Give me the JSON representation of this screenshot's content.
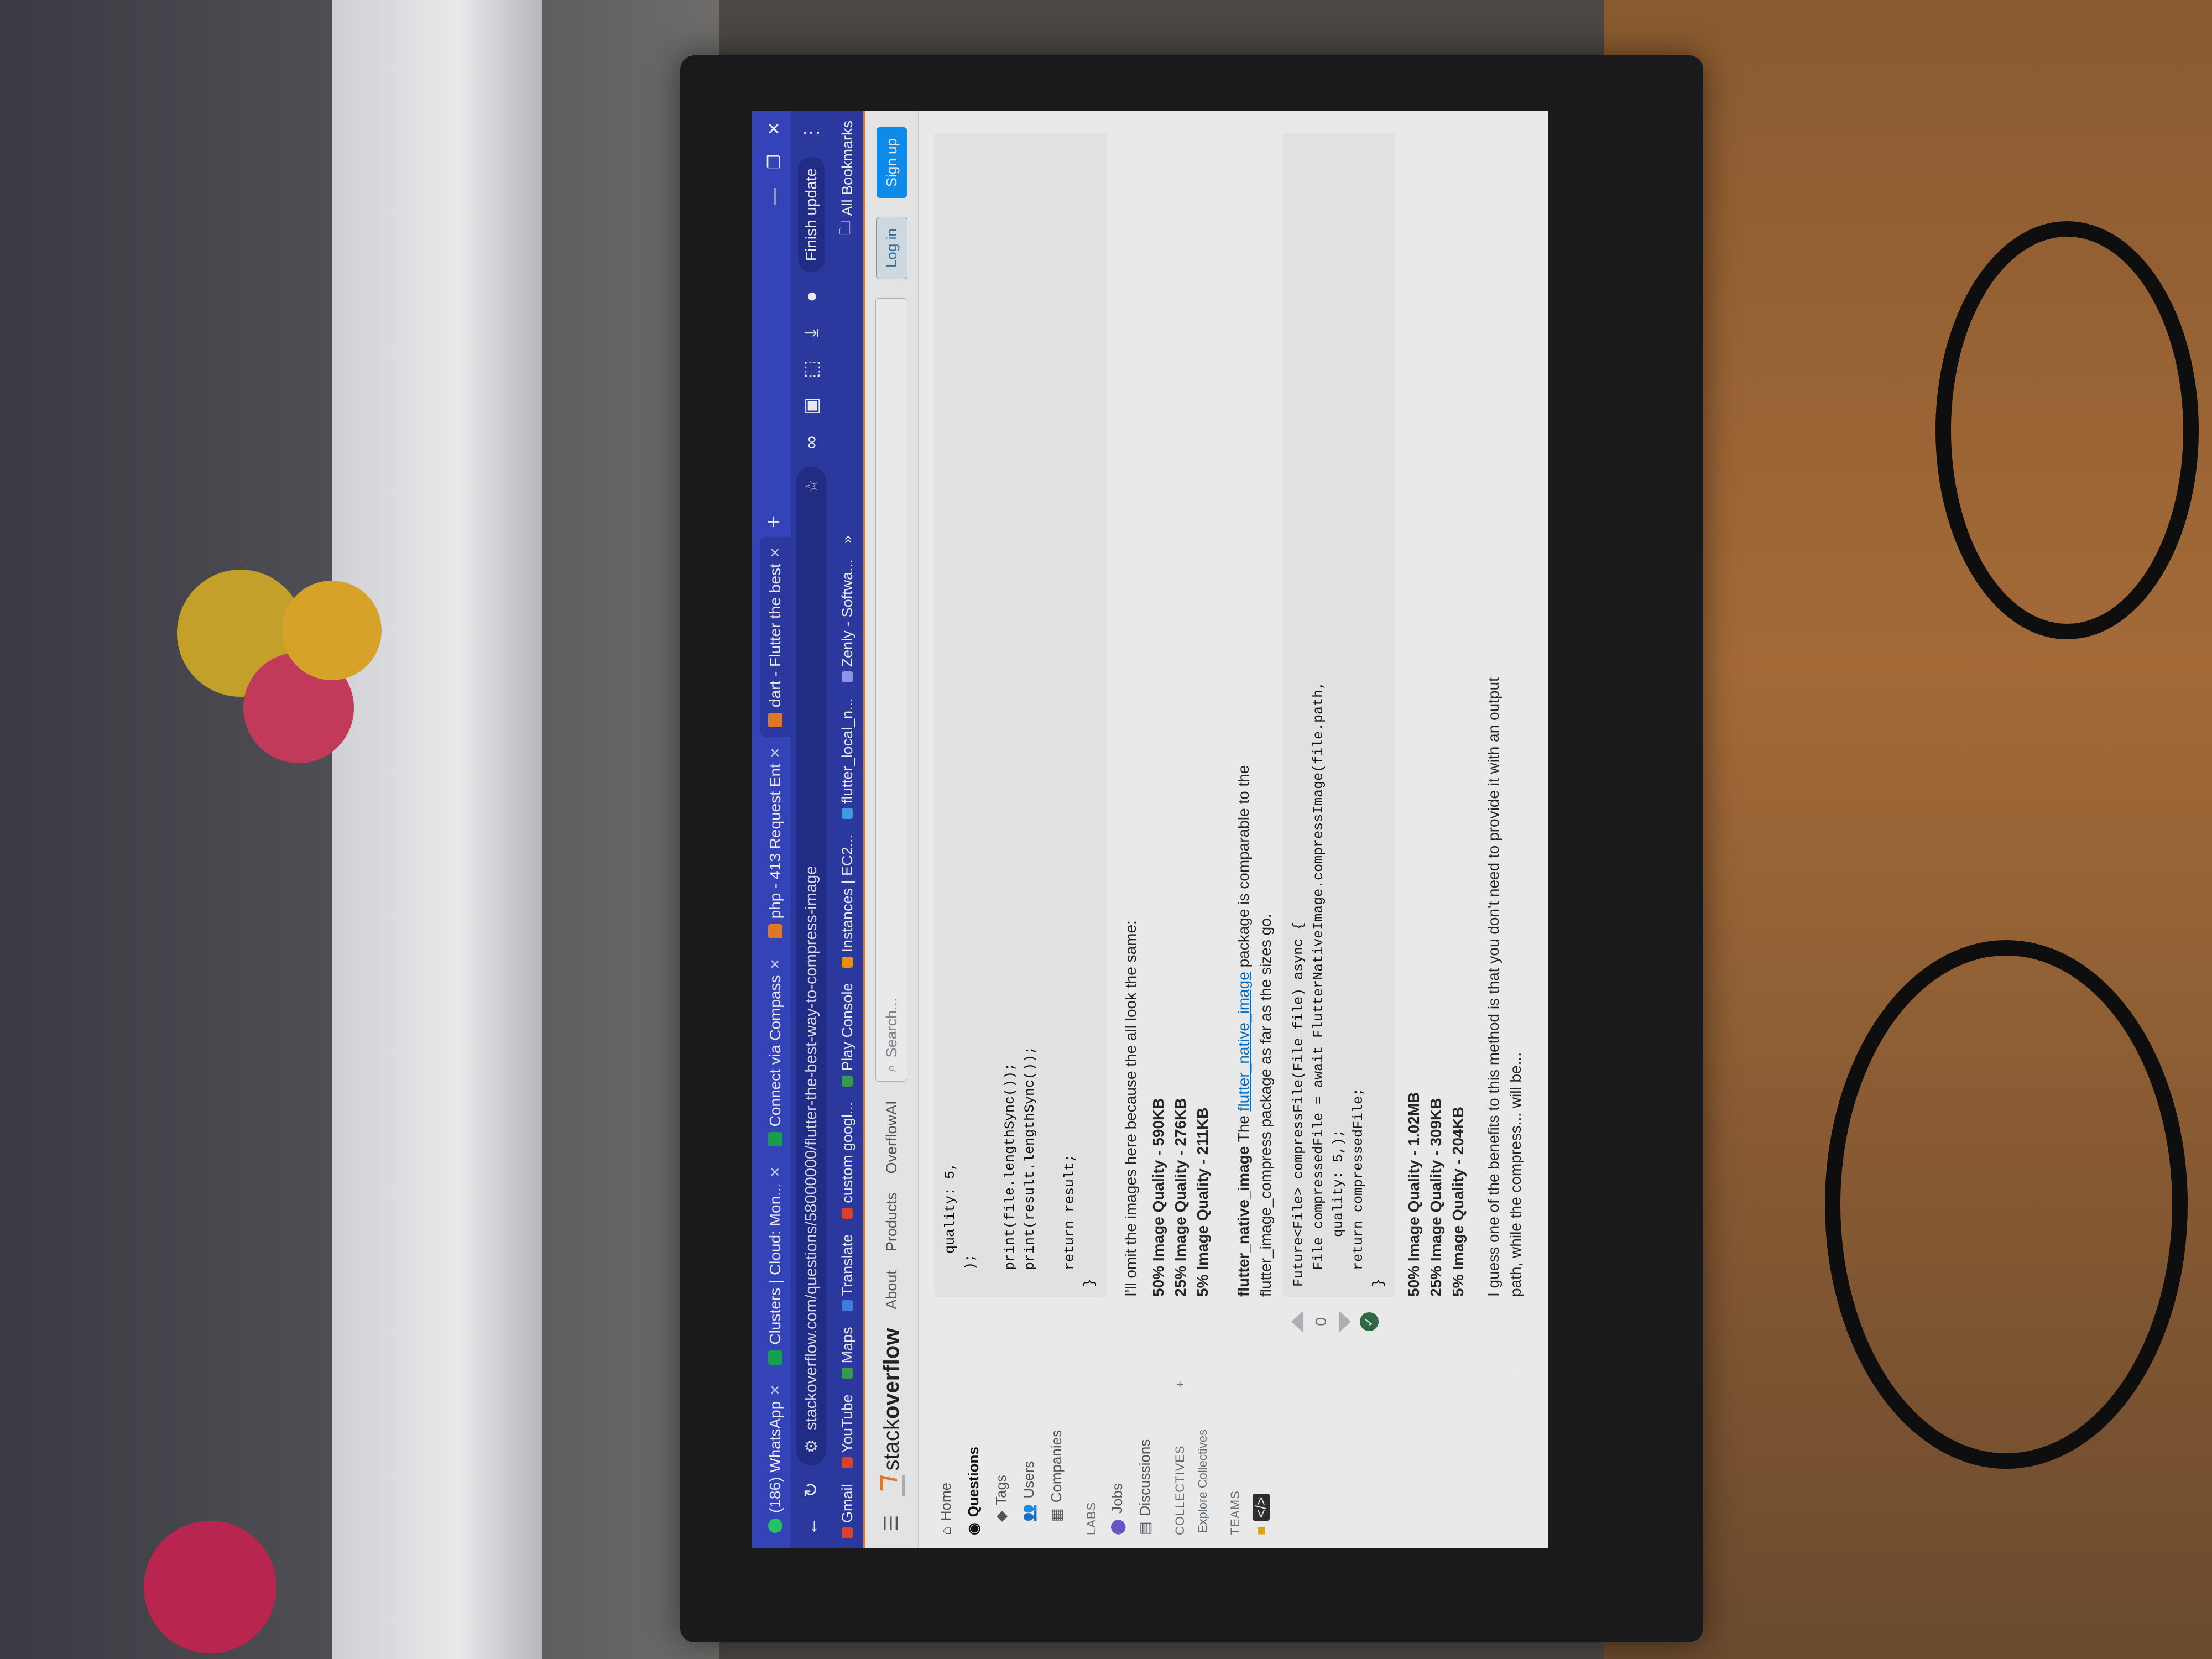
{
  "browser": {
    "tabs": [
      {
        "label": "(186) WhatsApp"
      },
      {
        "label": "Clusters | Cloud: Mon..."
      },
      {
        "label": "Connect via Compass"
      },
      {
        "label": "php - 413 Request Ent"
      },
      {
        "label": "dart - Flutter the best"
      }
    ],
    "url": "stackoverflow.com/questions/58000000/flutter-the-best-way-to-compress-image",
    "finish_update": "Finish update",
    "bookmarks": [
      "Gmail",
      "YouTube",
      "Maps",
      "Translate",
      "custom googl...",
      "Play Console",
      "Instances | EC2...",
      "flutter_local_n...",
      "Zenly - Softwa..."
    ],
    "all_bookmarks": "All Bookmarks"
  },
  "so": {
    "logo_prefix": "stack",
    "logo_suffix": "overflow",
    "nav": [
      "About",
      "Products",
      "OverflowAI"
    ],
    "search_placeholder": "Search...",
    "login": "Log in",
    "signup": "Sign up",
    "sidebar": {
      "home": "Home",
      "questions": "Questions",
      "tags": "Tags",
      "users": "Users",
      "companies": "Companies",
      "labs_head": "LABS",
      "jobs": "Jobs",
      "discussions": "Discussions",
      "collectives_head": "COLLECTIVES",
      "explore_collectives": "Explore Collectives",
      "teams_head": "TEAMS"
    }
  },
  "answer": {
    "code_top": "    quality: 5,\n  );\n\n  print(file.lengthSync());\n  print(result.lengthSync());\n\n  return result;\n}",
    "omit_text": "I'll omit the images here because the all look the same:",
    "results_a": [
      "50% Image Quality - 590KB",
      "25% Image Quality - 276KB",
      "5% Image Quality - 211KB"
    ],
    "native_bold": "flutter_native_image",
    "native_text_1": " The ",
    "native_link": "flutter_native_image",
    "native_text_2": " package is comparable to the",
    "native_text_3": "flutter_image_compress package as far as the sizes go.",
    "code_bottom": "Future<File> compressFile(File file) async {\n  File compressedFile = await FlutterNativeImage.compressImage(file.path,\n      quality: 5,);\n  return compressedFile;\n}",
    "results_b": [
      "50% Image Quality - 1.02MB",
      "25% Image Quality - 309KB",
      "5% Image Quality - 204KB"
    ],
    "closing": "I guess one of the benefits to this method is that you don't need to provide it with an output",
    "closing_2": "path, while the compress... will be...",
    "vote_count": "0"
  }
}
